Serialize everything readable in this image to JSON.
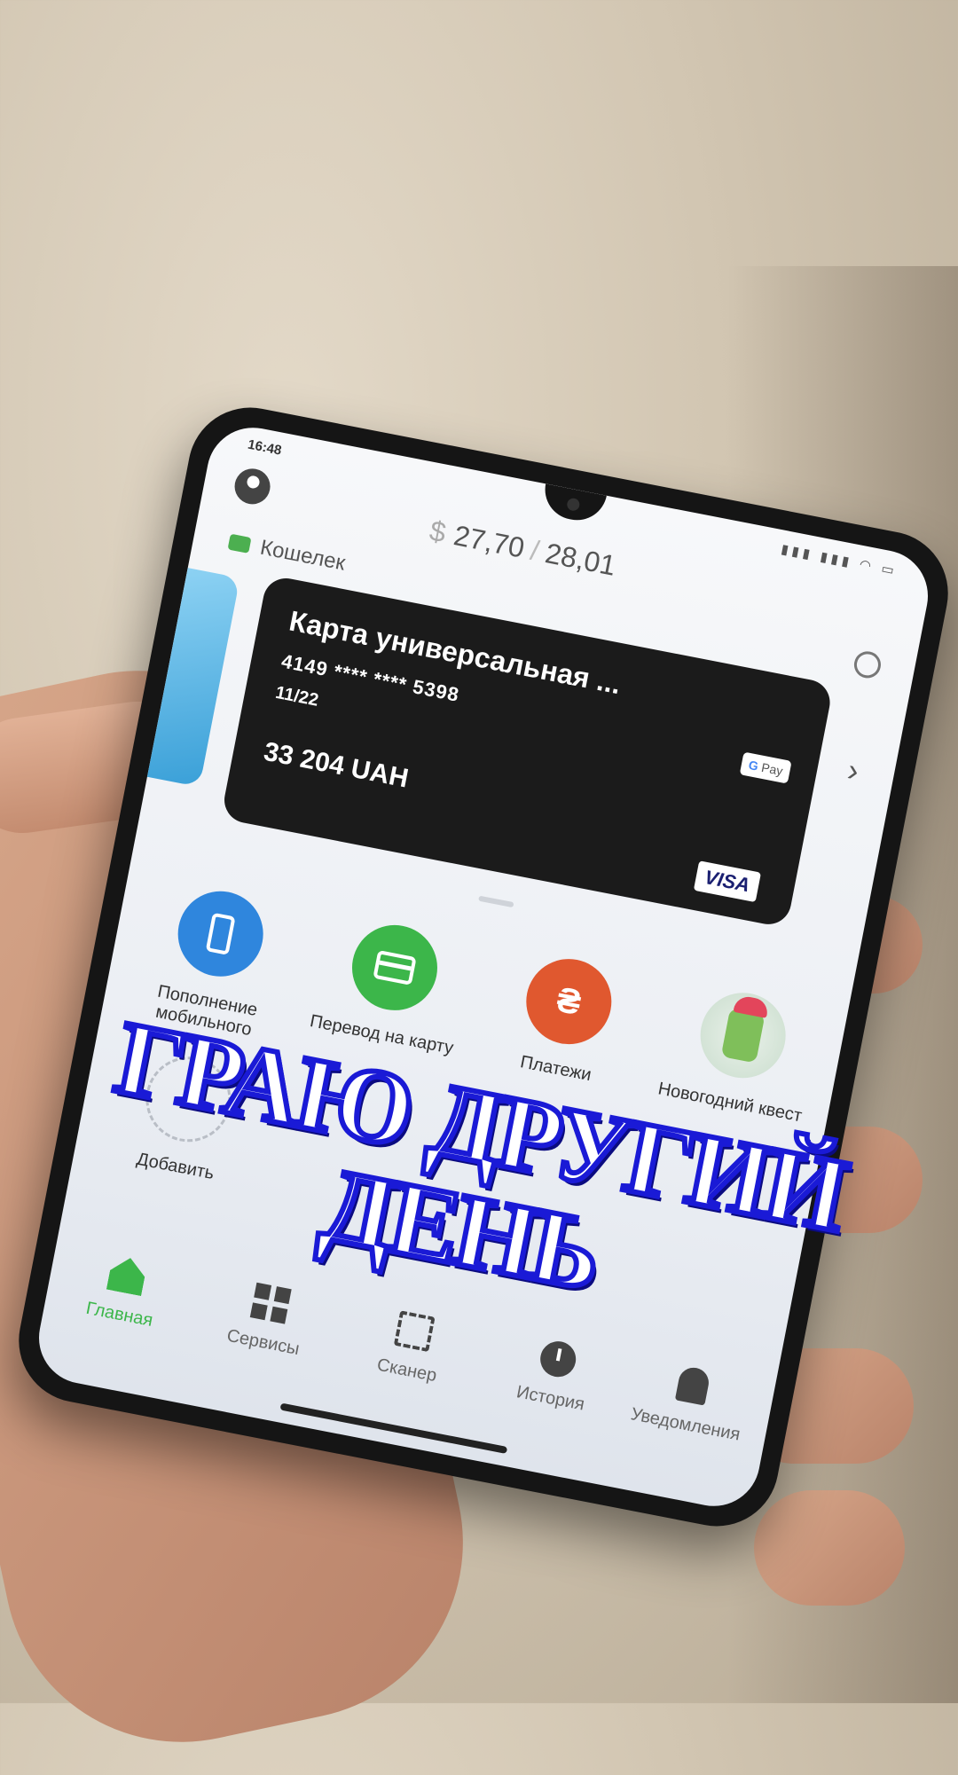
{
  "status": {
    "time": "16:48"
  },
  "header": {
    "rate_buy": "27,70",
    "rate_separator": "/",
    "rate_sell": "28,01",
    "currency_symbol": "$",
    "wallet_label": "Кошелек"
  },
  "card": {
    "name": "Карта универсальная ...",
    "number": "4149 **** **** 5398",
    "expiry": "11/22",
    "balance": "33 204 UAH",
    "gpay_label": "Pay",
    "brand": "VISA"
  },
  "actions": [
    {
      "label": "Пополнение мобильного",
      "color": "#2f86dd",
      "icon": "phone-icon"
    },
    {
      "label": "Перевод на карту",
      "color": "#3cb64a",
      "icon": "card-icon"
    },
    {
      "label": "Платежи",
      "color": "#e0582f",
      "icon": "hryvnia-icon"
    },
    {
      "label": "Новогодний квест",
      "color": "#c9ddcd",
      "icon": "quest-icon"
    },
    {
      "label": "Добавить",
      "icon": "plus-icon"
    }
  ],
  "hryvnia_glyph": "₴",
  "plus_glyph": "+",
  "nav": [
    {
      "label": "Главная",
      "icon": "home-icon",
      "active": true
    },
    {
      "label": "Сервисы",
      "icon": "grid-icon"
    },
    {
      "label": "Сканер",
      "icon": "scan-icon"
    },
    {
      "label": "История",
      "icon": "clock-icon"
    },
    {
      "label": "Уведомления",
      "icon": "bell-icon"
    }
  ],
  "overlay_caption": "ГРАЮ ДРУГИЙ ДЕНЬ",
  "colors": {
    "accent_green": "#3cb64a",
    "caption_outline": "#1a1ad6"
  }
}
